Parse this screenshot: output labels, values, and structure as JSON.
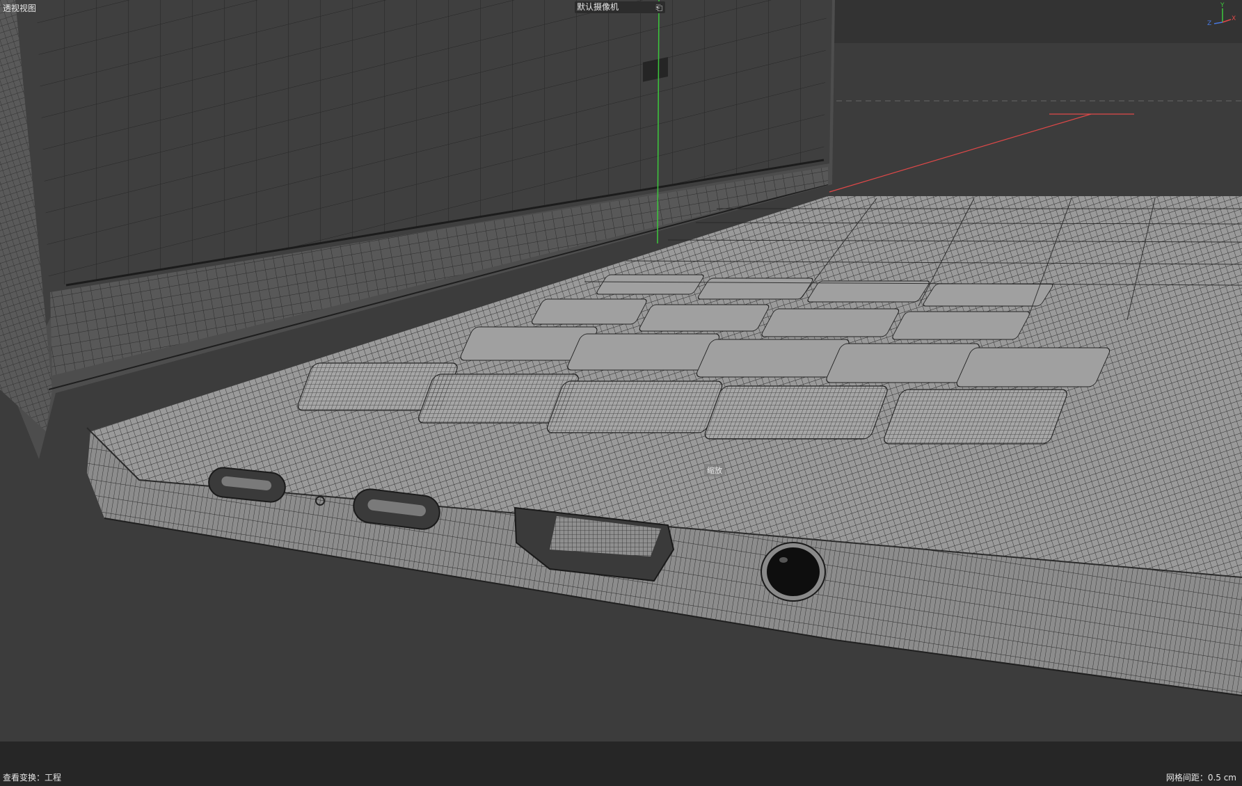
{
  "viewport": {
    "view_name": "透视视图",
    "camera_name": "默认摄像机",
    "camera_icon": "camera-switch-icon",
    "scale_label": "缩放",
    "axis_labels": {
      "y": "Y",
      "x": "X",
      "z": "Z"
    }
  },
  "statusbar": {
    "left_label": "查看变换：工程",
    "right_label": "网格间距：0.5 cm"
  },
  "colors": {
    "viewport_bg": "#3c3c3c",
    "statusbar_bg": "#262626",
    "axis_x": "#e04848",
    "axis_y": "#3cc83c",
    "axis_z": "#4878e0",
    "mesh_surface": "#9a9a9a",
    "wire": "#2a2a2a"
  }
}
